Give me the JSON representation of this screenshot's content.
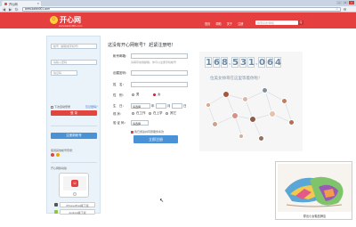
{
  "browser": {
    "tab_title": "开心网",
    "tab_close": "×",
    "url": "www.kaixin001.com",
    "back": "◀",
    "forward": "▶",
    "reload": "↻",
    "star": "☆",
    "wrench": "⚙",
    "minimize": "–",
    "maximize": "□",
    "close": "×"
  },
  "header": {
    "logo_glyph": "☺",
    "logo_name": "开心网",
    "logo_domain": "www.kaixin001.com",
    "links": [
      "首页",
      "帮助",
      "关于",
      "注册"
    ],
    "search_placeholder": "搜索好友/群组",
    "search_button": "Q"
  },
  "login": {
    "email_placeholder": "帐号（邮箱或手机号）",
    "password_placeholder": "请输入密码",
    "captcha_placeholder": "验证码",
    "remember_label": "下次自动登录",
    "forgot_link": "忘记密码？",
    "login_button": "登 录",
    "register_button": "注册新帐号",
    "other_login_label": "使用其他帐号登录：",
    "mobile_title": "开心网移动版",
    "phone_logo": "☺",
    "iphone_download": "iPhone/iPad版下载",
    "android_download": "Android版下载"
  },
  "form": {
    "title": "这没有开心网帐号？ 赶紧注册吧！",
    "account_label": "帐号邮箱：",
    "account_hint": "请填写常用邮箱，你可以注册手机帐号",
    "password_label": "创建密码：",
    "name_label": "姓　名：",
    "gender_label": "性　别：",
    "gender_male": "男",
    "gender_female": "女",
    "birthday_label": "生　日：",
    "birthday_year": "请选择",
    "birthday_year_unit": "年",
    "birthday_month_unit": "月",
    "birthday_day_unit": "日",
    "status_label": "现 状：",
    "status_options": [
      "在工作",
      "在上学",
      "其它"
    ],
    "captcha_label": "验 证 码：",
    "captcha_value": "请选择",
    "agree_text": "我已阅读并同意服务条款",
    "submit_button": "立即注册"
  },
  "stats": {
    "counter_digits": [
      "1",
      "6",
      "8",
      ",",
      "5",
      "3",
      "1",
      ",",
      "0",
      "6",
      "4"
    ],
    "slogan": "位美女帅哥在这里等着你啦！"
  },
  "ad": {
    "caption": "穿出小女鞋品牌店"
  },
  "colors": {
    "brand_red": "#e63f3f",
    "brand_blue": "#4a92d6",
    "counter_blue": "#6f8aa3"
  }
}
